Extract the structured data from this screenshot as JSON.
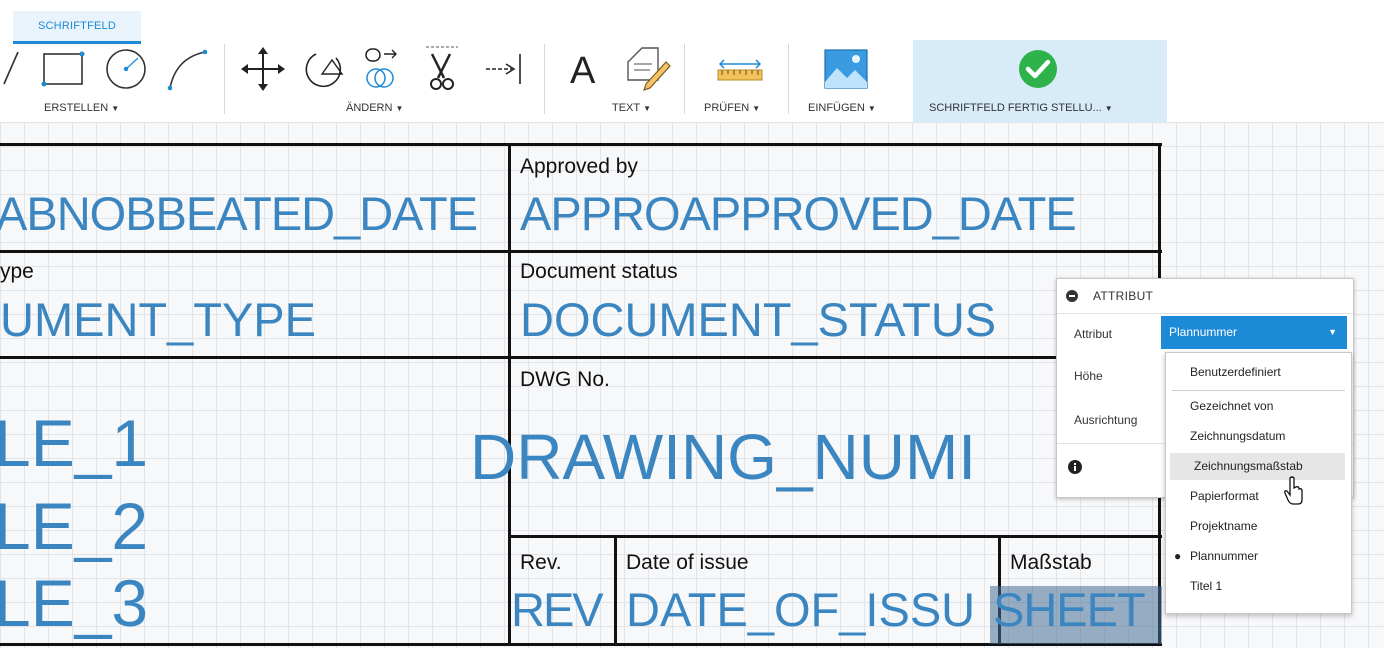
{
  "tab": {
    "label": "SCHRIFTFELD"
  },
  "toolbar": {
    "create_label": "ERSTELLEN",
    "modify_label": "ÄNDERN",
    "text_label": "TEXT",
    "check_label": "PRÜFEN",
    "insert_label": "EINFÜGEN",
    "finish_label": "SCHRIFTFELD FERTIG STELLU...",
    "text_tool_glyph": "A",
    "accent_color": "#1e8ad6",
    "finish_color": "#2db34a"
  },
  "title_block": {
    "cell_a_value": "ABNOBBEATED_DATE",
    "approved_label": "Approved by",
    "approved_value": "APPROAPPROVED_DATE",
    "type_label": "ype",
    "type_value": "UMENT_TYPE",
    "status_label": "Document status",
    "status_value": "DOCUMENT_STATUS",
    "dwg_label": "DWG No.",
    "dwg_value": "DRAWING_NUMI",
    "title_1": "LE_1",
    "title_2": "LE_2",
    "title_3": "LE_3",
    "rev_label": "Rev.",
    "rev_value": "REV",
    "date_label": "Date of issue",
    "date_value": "DATE_OF_ISSU",
    "scale_label": "Maßstab",
    "sheet_value": "SHEET",
    "text_color": "#3b86c0"
  },
  "attribute_panel": {
    "title": "ATTRIBUT",
    "attribute_label": "Attribut",
    "height_label": "Höhe",
    "alignment_label": "Ausrichtung",
    "selected_value": "Plannummer",
    "options": [
      "Benutzerdefiniert",
      "Gezeichnet von",
      "Zeichnungsdatum",
      "Zeichnungsmaßstab",
      "Papierformat",
      "Projektname",
      "Plannummer",
      "Titel 1"
    ],
    "hovered_option": "Zeichnungsmaßstab",
    "selected_option_marker": "●"
  }
}
